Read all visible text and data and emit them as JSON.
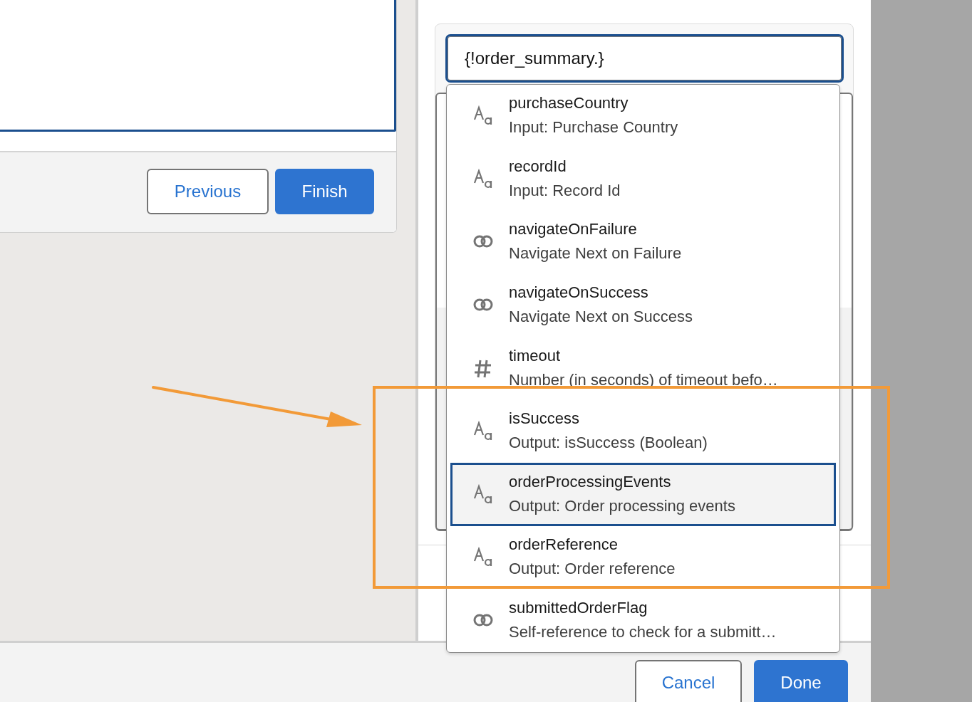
{
  "flow_screen": {
    "buttons": [
      {
        "label": "Previous",
        "kind": "neutral"
      },
      {
        "label": "Finish",
        "kind": "brand"
      }
    ]
  },
  "resource_picker": {
    "value": "{!order_summary.}",
    "options": [
      {
        "name": "purchaseCountry",
        "description": "Input: Purchase Country",
        "kind": "text",
        "selected": false
      },
      {
        "name": "recordId",
        "description": "Input: Record Id",
        "kind": "text",
        "selected": false
      },
      {
        "name": "navigateOnFailure",
        "description": "Navigate Next on Failure",
        "kind": "boolean",
        "selected": false
      },
      {
        "name": "navigateOnSuccess",
        "description": "Navigate Next on Success",
        "kind": "boolean",
        "selected": false
      },
      {
        "name": "timeout",
        "description": "Number (in seconds) of timeout befo…",
        "kind": "number",
        "selected": false
      },
      {
        "name": "isSuccess",
        "description": "Output: isSuccess (Boolean)",
        "kind": "text",
        "selected": false
      },
      {
        "name": "orderProcessingEvents",
        "description": "Output: Order processing events",
        "kind": "text",
        "selected": true
      },
      {
        "name": "orderReference",
        "description": "Output: Order reference",
        "kind": "text",
        "selected": false
      },
      {
        "name": "submittedOrderFlag",
        "description": "Self-reference to check for a submitt…",
        "kind": "boolean",
        "selected": false
      }
    ]
  },
  "footer": {
    "buttons": [
      {
        "label": "Cancel",
        "kind": "neutral"
      },
      {
        "label": "Done",
        "kind": "brand"
      }
    ]
  }
}
